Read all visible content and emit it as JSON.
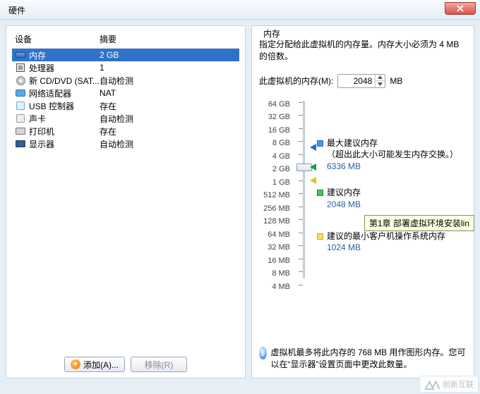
{
  "window": {
    "title": "硬件"
  },
  "device_list": {
    "header_device": "设备",
    "header_summary": "摘要",
    "items": [
      {
        "name": "内存",
        "summary": "2 GB",
        "icon": "memory"
      },
      {
        "name": "处理器",
        "summary": "1",
        "icon": "cpu"
      },
      {
        "name": "新 CD/DVD (SAT...",
        "summary": "自动检测",
        "icon": "cd"
      },
      {
        "name": "网络适配器",
        "summary": "NAT",
        "icon": "net"
      },
      {
        "name": "USB 控制器",
        "summary": "存在",
        "icon": "usb"
      },
      {
        "name": "声卡",
        "summary": "自动检测",
        "icon": "sound"
      },
      {
        "name": "打印机",
        "summary": "存在",
        "icon": "printer"
      },
      {
        "name": "显示器",
        "summary": "自动检测",
        "icon": "display"
      }
    ],
    "selected_index": 0
  },
  "buttons": {
    "add": "添加(A)...",
    "remove": "移除(R)"
  },
  "memory_panel": {
    "group_title": "内存",
    "description": "指定分配给此虚拟机的内存量。内存大小必须为 4 MB 的倍数。",
    "label": "此虚拟机的内存(M):",
    "value": "2048",
    "unit": "MB",
    "slider_labels": [
      "64 GB",
      "32 GB",
      "16 GB",
      "8 GB",
      "4 GB",
      "2 GB",
      "1 GB",
      "512 MB",
      "256 MB",
      "128 MB",
      "64 MB",
      "32 MB",
      "16 MB",
      "8 MB",
      "4 MB"
    ],
    "max_rec_title": "最大建议内存",
    "max_rec_note": "（超出此大小可能发生内存交换。）",
    "max_rec_value": "6336 MB",
    "rec_title": "建议内存",
    "rec_value": "2048 MB",
    "min_rec_title": "建议的最小客户机操作系统内存",
    "min_rec_value": "1024 MB",
    "info_text_1": "虚拟机最多将此内存的 768 MB 用作图形内存。您可以在“显示器”设置页面中更改此数量。",
    "tooltip": "第1章 部署虚拟环境安装lin"
  },
  "watermark": "创新互联"
}
